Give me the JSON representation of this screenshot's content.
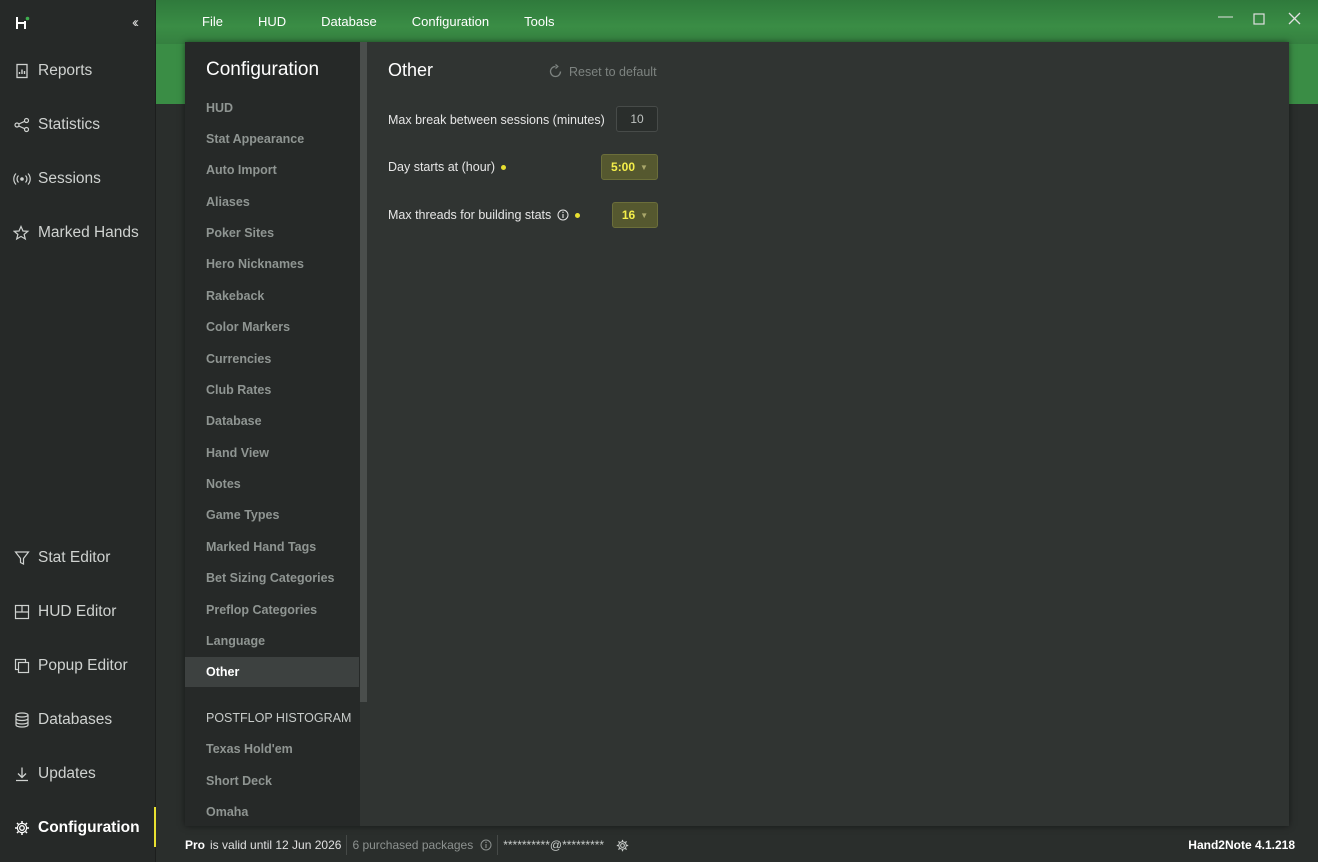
{
  "app": {
    "version": "Hand2Note 4.1.218",
    "accent": "#e8e030",
    "titlebar_color": "#3a8d45"
  },
  "leftnav": {
    "top_items": [
      {
        "label": "Reports",
        "icon": "reports-icon"
      },
      {
        "label": "Statistics",
        "icon": "statistics-icon"
      },
      {
        "label": "Sessions",
        "icon": "sessions-icon"
      },
      {
        "label": "Marked Hands",
        "icon": "star-icon"
      }
    ],
    "bottom_items": [
      {
        "label": "Stat Editor",
        "icon": "filter-icon"
      },
      {
        "label": "HUD Editor",
        "icon": "hud-editor-icon"
      },
      {
        "label": "Popup Editor",
        "icon": "popup-editor-icon"
      },
      {
        "label": "Databases",
        "icon": "database-icon"
      },
      {
        "label": "Updates",
        "icon": "download-icon"
      },
      {
        "label": "Configuration",
        "icon": "gear-icon"
      }
    ]
  },
  "menu": {
    "items": [
      "File",
      "HUD",
      "Database",
      "Configuration",
      "Tools"
    ]
  },
  "config": {
    "title": "Configuration",
    "items": [
      "HUD",
      "Stat Appearance",
      "Auto Import",
      "Aliases",
      "Poker Sites",
      "Hero Nicknames",
      "Rakeback",
      "Color Markers",
      "Currencies",
      "Club Rates",
      "Database",
      "Hand View",
      "Notes",
      "Game Types",
      "Marked Hand Tags",
      "Bet Sizing Categories",
      "Preflop Categories",
      "Language",
      "Other"
    ],
    "selected": "Other",
    "section_header": "POSTFLOP HISTOGRAM",
    "section_items": [
      "Texas Hold'em",
      "Short Deck",
      "Omaha"
    ]
  },
  "content": {
    "title": "Other",
    "reset_label": "Reset to default",
    "max_break_label": "Max break between sessions (minutes)",
    "max_break_value": "10",
    "day_starts_label": "Day starts at (hour)",
    "day_starts_value": "5:00",
    "max_threads_label": "Max threads for building stats",
    "max_threads_value": "16"
  },
  "status": {
    "plan": "Pro",
    "validity": "is valid until 12 Jun 2026",
    "packages": "6 purchased packages",
    "email": "**********@*********"
  }
}
